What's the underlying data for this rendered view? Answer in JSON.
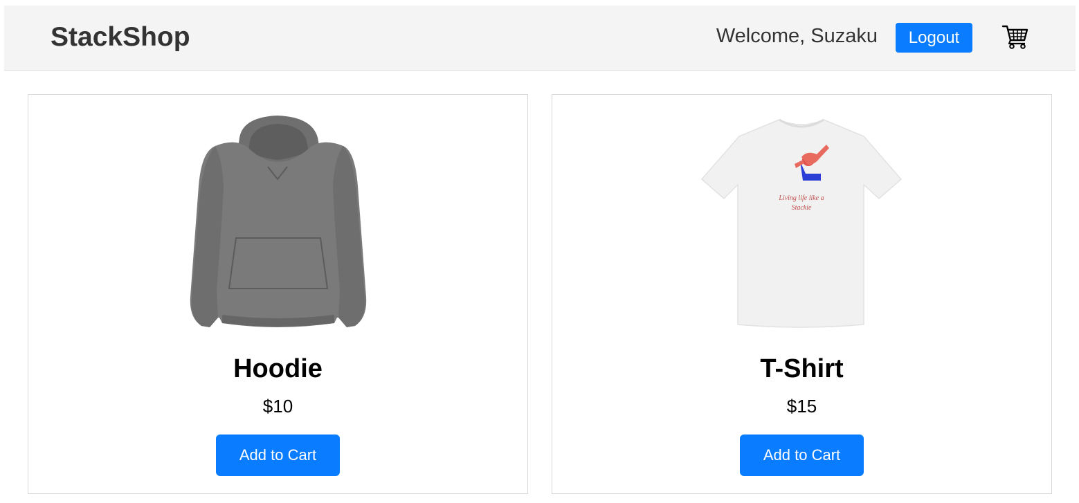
{
  "header": {
    "brand": "StackShop",
    "welcome_text": "Welcome, Suzaku",
    "logout_label": "Logout",
    "cart_icon": "shopping-cart-icon"
  },
  "products": [
    {
      "name": "Hoodie",
      "price": "$10",
      "add_label": "Add to Cart",
      "image": "gray-hoodie-image",
      "color": "#7a7a7a"
    },
    {
      "name": "T-Shirt",
      "price": "$15",
      "add_label": "Add to Cart",
      "image": "white-tshirt-image",
      "print_text_line1": "Living life like a",
      "print_text_line2": "Stackie",
      "color": "#f4f4f4"
    }
  ],
  "colors": {
    "accent": "#0a7cff",
    "header_bg": "#f4f4f4",
    "print_text": "#c0504d"
  }
}
